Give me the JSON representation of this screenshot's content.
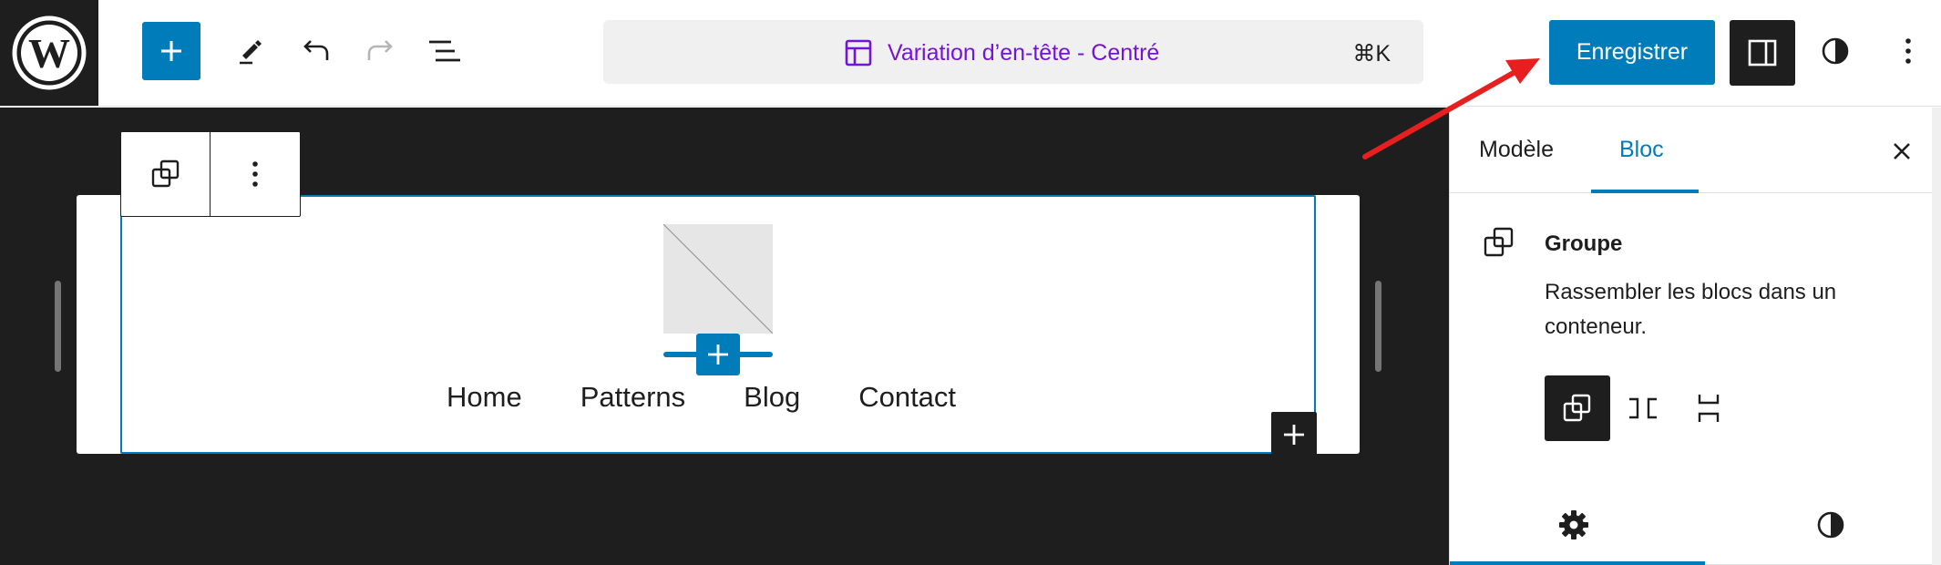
{
  "toolbar": {
    "command_bar": {
      "title": "Variation d’en-tête - Centré",
      "shortcut": "⌘K"
    },
    "save_label": "Enregistrer"
  },
  "canvas": {
    "navigation": [
      "Home",
      "Patterns",
      "Blog",
      "Contact"
    ]
  },
  "sidebar": {
    "tabs": [
      {
        "label": "Modèle",
        "active": false
      },
      {
        "label": "Bloc",
        "active": true
      }
    ],
    "block_card": {
      "title": "Groupe",
      "description": "Rassembler les blocs dans un conteneur."
    },
    "variations": [
      "group",
      "row",
      "stack"
    ],
    "inspector_tabs": [
      "settings",
      "styles"
    ]
  },
  "colors": {
    "accent": "#007cba",
    "dark": "#1e1e1e",
    "template_purple": "#7414d4",
    "annotation_arrow": "#e81f1f"
  },
  "icons": {
    "logo": "wordpress-logo-icon",
    "add": "plus-icon",
    "tools": "pen-icon",
    "undo": "undo-icon",
    "redo": "redo-icon",
    "list_view": "list-view-icon",
    "template": "template-layout-icon",
    "sidebar": "sidebar-toggle-icon",
    "styles": "half-circle-styles-icon",
    "options": "vertical-ellipsis-icon",
    "close": "close-icon",
    "group": "group-block-icon",
    "settings": "gear-icon"
  }
}
